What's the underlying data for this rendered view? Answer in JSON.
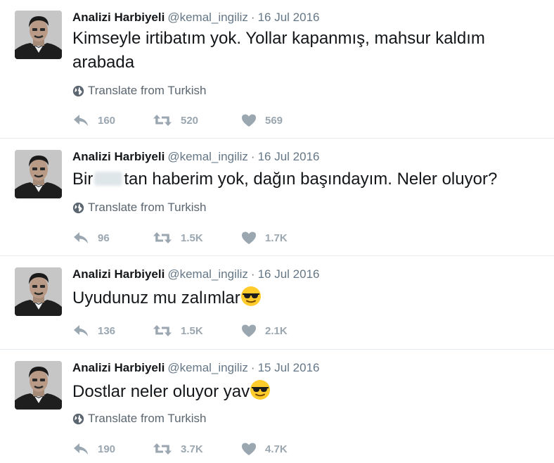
{
  "colors": {
    "name": "#14171a",
    "meta": "#657786",
    "action": "#9aa6b0",
    "divider": "#e6ecf0"
  },
  "translate_label": "Translate from Turkish",
  "tweets": [
    {
      "name": "Analizi Harbiyeli",
      "handle": "@kemal_ingiliz",
      "dot": "·",
      "date": "16 Jul 2016",
      "text_line1": "Kimseyle irtibatım yok. Yollar kapanmış, mahsur kaldım",
      "text_line2": "arabada",
      "replies": "160",
      "retweets": "520",
      "likes": "569"
    },
    {
      "name": "Analizi Harbiyeli",
      "handle": "@kemal_ingiliz",
      "dot": "·",
      "date": "16 Jul 2016",
      "text_before": "Bir",
      "text_after": "tan haberim yok, dağın başındayım. Neler oluyor?",
      "replies": "96",
      "retweets": "1.5K",
      "likes": "1.7K"
    },
    {
      "name": "Analizi Harbiyeli",
      "handle": "@kemal_ingiliz",
      "dot": "·",
      "date": "16 Jul 2016",
      "text": "Uyudunuz mu zalımlar",
      "emoji": "sunglasses-emoji",
      "replies": "136",
      "retweets": "1.5K",
      "likes": "2.1K"
    },
    {
      "name": "Analizi Harbiyeli",
      "handle": "@kemal_ingiliz",
      "dot": "·",
      "date": "15 Jul 2016",
      "text": "Dostlar neler oluyor yav",
      "emoji": "sunglasses-emoji",
      "replies": "190",
      "retweets": "3.7K",
      "likes": "4.7K"
    }
  ]
}
